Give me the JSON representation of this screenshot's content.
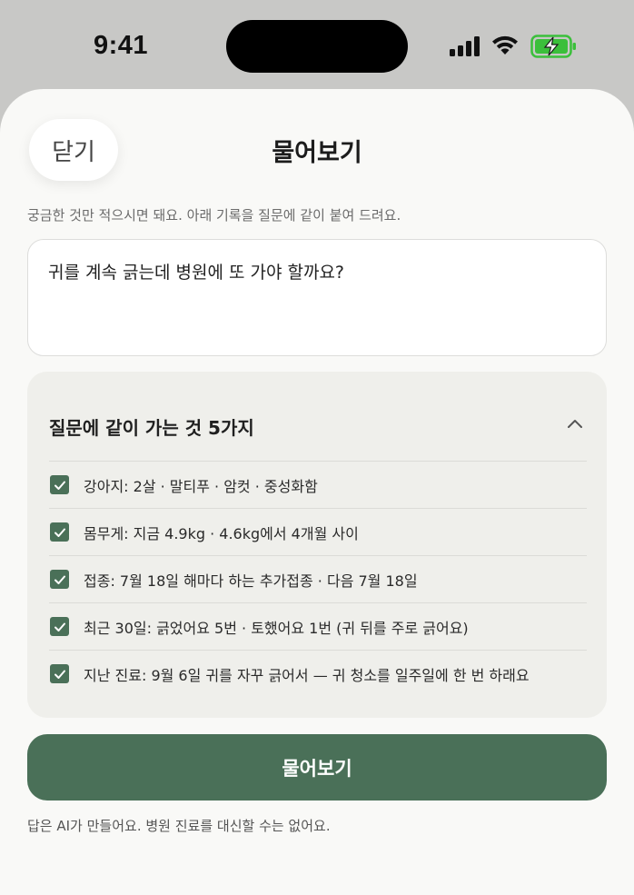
{
  "status_bar": {
    "time": "9:41",
    "battery_color": "#3bbf3b"
  },
  "header": {
    "close_label": "닫기",
    "title": "물어보기"
  },
  "helper_text": "궁금한 것만 적으시면 돼요. 아래 기록을 질문에 같이 붙여 드려요.",
  "question": {
    "value": "귀를 계속 긁는데 병원에 또 가야 할까요?"
  },
  "context": {
    "title": "질문에 같이 가는 것 5가지",
    "expanded": true,
    "items": [
      {
        "label": "강아지: 2살 · 말티푸 · 암컷 · 중성화함",
        "checked": true
      },
      {
        "label": "몸무게: 지금 4.9kg · 4.6kg에서 4개월 사이",
        "checked": true
      },
      {
        "label": "접종: 7월 18일 해마다 하는 추가접종 · 다음 7월 18일",
        "checked": true
      },
      {
        "label": "최근 30일: 긁었어요 5번 · 토했어요 1번 (귀 뒤를 주로 긁어요)",
        "checked": true
      },
      {
        "label": "지난 진료: 9월 6일 귀를 자꾸 긁어서 — 귀 청소를 일주일에 한 번 하래요",
        "checked": true
      }
    ]
  },
  "submit_label": "물어보기",
  "disclaimer": "답은 AI가 만들어요. 병원 진료를 대신할 수는 없어요.",
  "colors": {
    "accent": "#4a7058",
    "sheet": "#f9f9f7",
    "card": "#efefeb"
  }
}
